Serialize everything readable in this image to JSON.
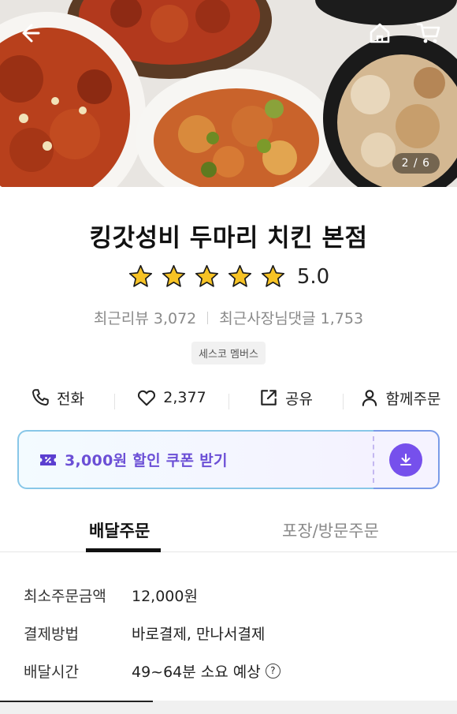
{
  "hero": {
    "image_counter": "2 / 6"
  },
  "store": {
    "name": "킹갓성비 두마리 치킨 본점",
    "rating": "5.0",
    "rating_stars": 5,
    "recent_reviews": "최근리뷰 3,072",
    "recent_owner_replies": "최근사장님댓글 1,753",
    "badge": "세스코 멤버스"
  },
  "actions": {
    "call": "전화",
    "likes": "2,377",
    "share": "공유",
    "group_order": "함께주문"
  },
  "coupon": {
    "label": "3,000원 할인 쿠폰 받기"
  },
  "tabs": {
    "delivery": "배달주문",
    "pickup": "포장/방문주문"
  },
  "info": {
    "min_order_label": "최소주문금액",
    "min_order_value": "12,000원",
    "payment_label": "결제방법",
    "payment_value": "바로결제, 만나서결제",
    "delivery_time_label": "배달시간",
    "delivery_time_value": "49~64분 소요 예상",
    "help_symbol": "?"
  },
  "colors": {
    "accent": "#7650ec",
    "coupon_text": "#6b4fd6",
    "star": "#f7c325"
  }
}
